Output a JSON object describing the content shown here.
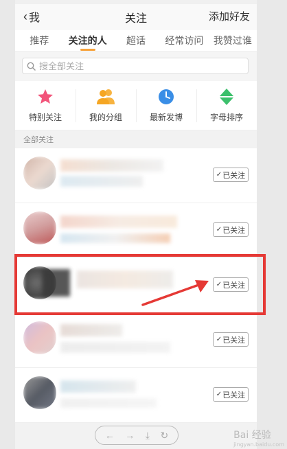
{
  "nav": {
    "back_label": "我",
    "title": "关注",
    "right_action": "添加好友"
  },
  "tabs": [
    {
      "label": "推荐",
      "active": false
    },
    {
      "label": "关注的人",
      "active": true
    },
    {
      "label": "超话",
      "active": false
    },
    {
      "label": "经常访问",
      "active": false
    },
    {
      "label": "我赞过谁",
      "active": false
    }
  ],
  "search": {
    "placeholder": "搜全部关注"
  },
  "quick_actions": [
    {
      "label": "特别关注",
      "icon": "star-icon",
      "color": "#f2547a"
    },
    {
      "label": "我的分组",
      "icon": "group-icon",
      "color": "#f5a623"
    },
    {
      "label": "最新发博",
      "icon": "clock-icon",
      "color": "#3a8ee6"
    },
    {
      "label": "字母排序",
      "icon": "sort-arrows-icon",
      "color": "#3cc06c"
    }
  ],
  "section": {
    "label": "全部关注"
  },
  "following": [
    {
      "button_label": "已关注"
    },
    {
      "button_label": "已关注"
    },
    {
      "button_label": "已关注"
    },
    {
      "button_label": "已关注"
    },
    {
      "button_label": "已关注"
    }
  ],
  "colors": {
    "accent": "#f7a23a",
    "highlight": "#e53935"
  },
  "watermark": {
    "text": "Bai 经验",
    "subtext": "jingyan.baidu.com"
  },
  "bottom_bar": {
    "icons": [
      "arrow-left-icon",
      "arrow-right-icon",
      "download-icon",
      "refresh-icon"
    ]
  }
}
